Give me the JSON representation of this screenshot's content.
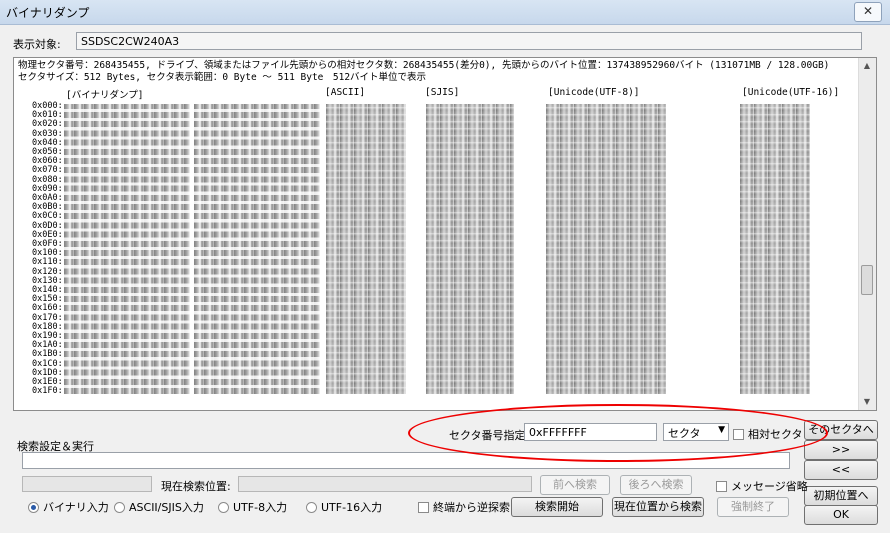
{
  "window": {
    "title": "バイナリダンプ",
    "close_glyph": "✕"
  },
  "target": {
    "label": "表示対象:",
    "value": "SSDSC2CW240A3"
  },
  "dump": {
    "info_line1": "物理セクタ番号：268435455, ドライブ、領域またはファイル先頭からの相対セクタ数：268435455(差分0), 先頭からのバイト位置：137438952960バイト (131071MB / 128.00GB)",
    "info_line2": "セクタサイズ：512 Bytes, セクタ表示範囲：0 Byte 〜 511 Byte　512バイト単位で表示",
    "headers": {
      "binary": "[バイナリダンプ]",
      "ascii": "[ASCII]",
      "sjis": "[SJIS]",
      "utf8": "[Unicode(UTF-8)]",
      "utf16": "[Unicode(UTF-16)]"
    },
    "addresses": [
      "0x000",
      "0x010",
      "0x020",
      "0x030",
      "0x040",
      "0x050",
      "0x060",
      "0x070",
      "0x080",
      "0x090",
      "0x0A0",
      "0x0B0",
      "0x0C0",
      "0x0D0",
      "0x0E0",
      "0x0F0",
      "0x100",
      "0x110",
      "0x120",
      "0x130",
      "0x140",
      "0x150",
      "0x160",
      "0x170",
      "0x180",
      "0x190",
      "0x1A0",
      "0x1B0",
      "0x1C0",
      "0x1D0",
      "0x1E0",
      "0x1F0"
    ]
  },
  "sector": {
    "label": "セクタ番号指定:",
    "value": "0xFFFFFFF",
    "unit_selected": "セクタ",
    "relative_label": "相対セクタ"
  },
  "nav": {
    "to_sector": "そのセクタへ",
    "next": ">>",
    "prev": "<<",
    "initial": "初期位置へ",
    "ok": "OK"
  },
  "search": {
    "section_label": "検索設定＆実行",
    "current_pos_label": "現在検索位置:",
    "search_prev": "前へ検索",
    "search_next": "後ろへ検索",
    "omit_message": "メッセージ省略",
    "mode_binary": "バイナリ入力",
    "mode_ascii": "ASCII/SJIS入力",
    "mode_utf8": "UTF-8入力",
    "mode_utf16": "UTF-16入力",
    "reverse_from_end": "終端から逆探索",
    "start": "検索開始",
    "search_from_current": "現在位置から検索",
    "force_stop": "強制終了"
  },
  "colors": {
    "highlight_ellipse": "#ee0000"
  }
}
